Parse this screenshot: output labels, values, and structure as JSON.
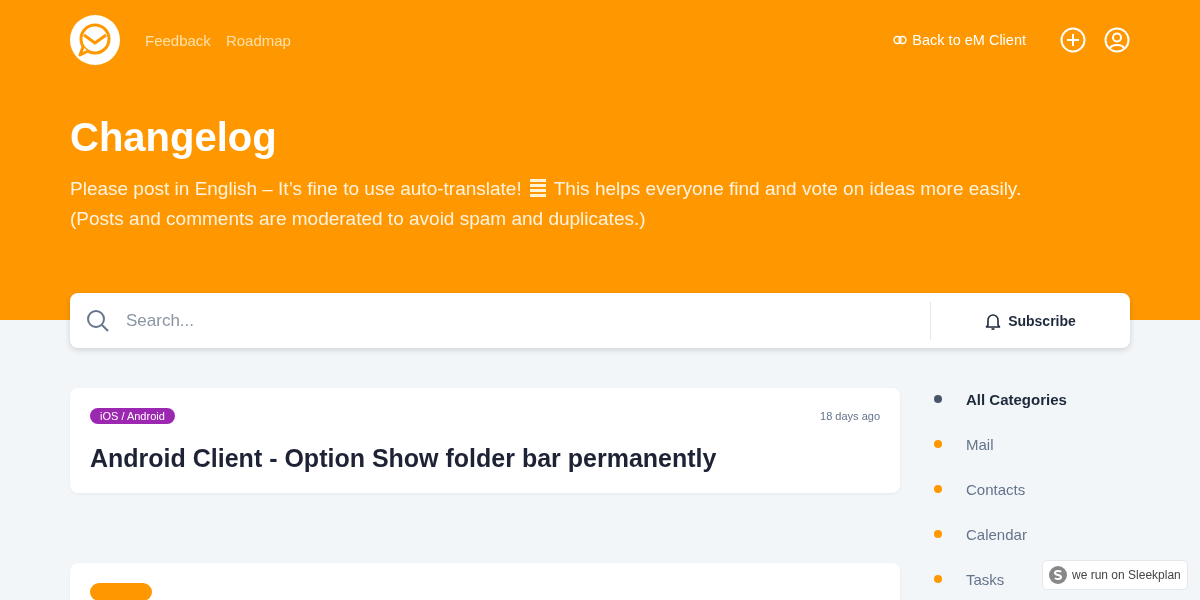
{
  "nav": {
    "links": [
      {
        "label": "Feedback"
      },
      {
        "label": "Roadmap"
      }
    ],
    "back_link": "Back to eM Client"
  },
  "header": {
    "title": "Changelog",
    "intro_before": "Please post in English – It’s fine to use auto-translate!",
    "intro_after": "This helps everyone find and vote on ideas more easily.",
    "intro_second": "(Posts and comments are moderated to avoid spam and duplicates.)"
  },
  "search": {
    "placeholder": "Search..."
  },
  "subscribe": "Subscribe",
  "posts": [
    {
      "tag": "iOS / Android",
      "color": "#9c27b0",
      "time": "18 days ago",
      "title": "Android Client - Option Show folder bar permanently"
    },
    {
      "color": "#ff9800"
    }
  ],
  "categories": [
    {
      "label": "All Categories",
      "selected": true,
      "color": "#475569"
    },
    {
      "label": "Mail",
      "selected": false,
      "color": "#ff9800"
    },
    {
      "label": "Contacts",
      "selected": false,
      "color": "#ff9800"
    },
    {
      "label": "Calendar",
      "selected": false,
      "color": "#ff9800"
    },
    {
      "label": "Tasks",
      "selected": false,
      "color": "#ff9800"
    }
  ],
  "badge": "we run on Sleekplan"
}
